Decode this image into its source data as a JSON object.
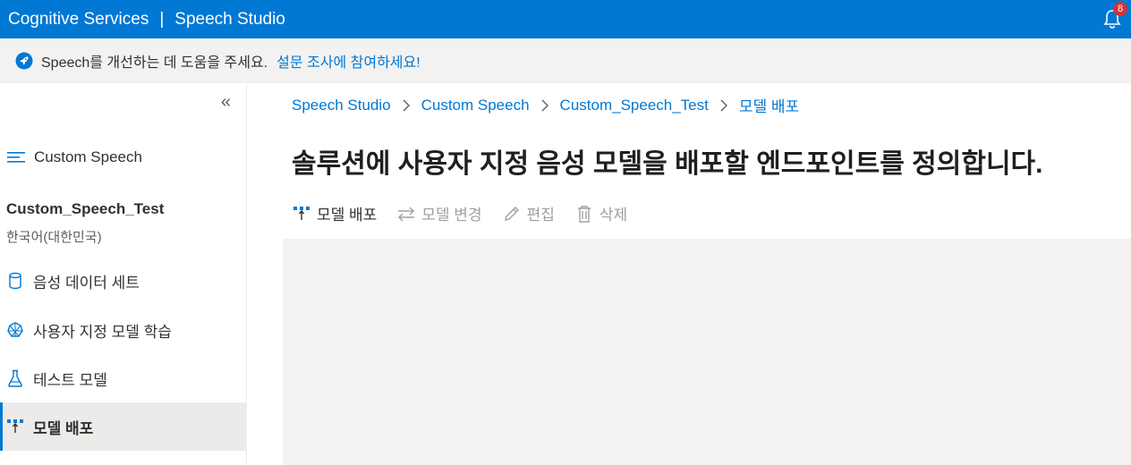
{
  "header": {
    "product": "Cognitive Services",
    "separator": "|",
    "app": "Speech Studio",
    "notification_count": "8"
  },
  "banner": {
    "text": "Speech를 개선하는 데 도움을 주세요.",
    "link": "설문 조사에 참여하세요!"
  },
  "sidebar": {
    "collapse_label": "«",
    "section": "Custom Speech",
    "project_name": "Custom_Speech_Test",
    "project_language": "한국어(대한민국)",
    "items": [
      {
        "label": "음성 데이터 세트",
        "icon": "database-icon"
      },
      {
        "label": "사용자 지정 모델 학습",
        "icon": "brain-icon"
      },
      {
        "label": "테스트 모델",
        "icon": "flask-icon"
      },
      {
        "label": "모델 배포",
        "icon": "deploy-icon",
        "active": true
      }
    ]
  },
  "breadcrumb": [
    "Speech Studio",
    "Custom Speech",
    "Custom_Speech_Test",
    "모델 배포"
  ],
  "page_title": "솔루션에 사용자 지정 음성 모델을 배포할 엔드포인트를 정의합니다.",
  "toolbar": {
    "deploy": "모델 배포",
    "change": "모델 변경",
    "edit": "편집",
    "delete": "삭제"
  },
  "colors": {
    "brand": "#0078d4",
    "banner_bg": "#f3f2f1",
    "active_bg": "#edebe9",
    "badge": "#d13438"
  }
}
